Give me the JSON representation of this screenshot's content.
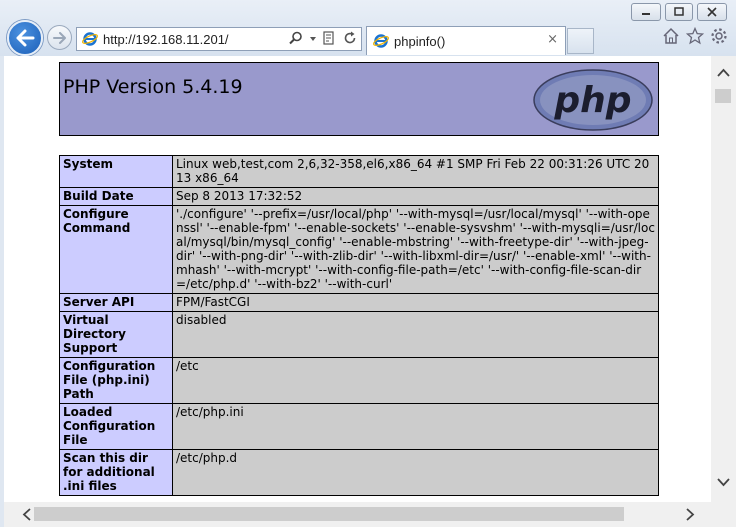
{
  "browser": {
    "address": "http://192.168.11.201/",
    "tab_title": "phpinfo()",
    "tab_close_glyph": "×",
    "colors": {
      "accent": "#1b5fb8",
      "chrome": "#dfe7f1"
    }
  },
  "page": {
    "header_title": "PHP Version 5.4.19",
    "logo_text": "php",
    "colors": {
      "header_bg": "#9999cc",
      "key_bg": "#ccccff",
      "value_bg": "#cccccc"
    },
    "rows": [
      {
        "key": "System",
        "value": "Linux web,test,com 2,6,32-358,el6,x86_64 #1 SMP Fri Feb 22 00:31:26 UTC 2013 x86_64"
      },
      {
        "key": "Build Date",
        "value": "Sep 8 2013 17:32:52"
      },
      {
        "key": "Configure Command",
        "value": "'./configure' '--prefix=/usr/local/php' '--with-mysql=/usr/local/mysql' '--with-openssl' '--enable-fpm' '--enable-sockets' '--enable-sysvshm' '--with-mysqli=/usr/local/mysql/bin/mysql_config' '--enable-mbstring' '--with-freetype-dir' '--with-jpeg-dir' '--with-png-dir' '--with-zlib-dir' '--with-libxml-dir=/usr/' '--enable-xml' '--with-mhash' '--with-mcrypt' '--with-config-file-path=/etc' '--with-config-file-scan-dir=/etc/php.d' '--with-bz2' '--with-curl'"
      },
      {
        "key": "Server API",
        "value": "FPM/FastCGI"
      },
      {
        "key": "Virtual Directory Support",
        "value": "disabled"
      },
      {
        "key": "Configuration File (php.ini) Path",
        "value": "/etc"
      },
      {
        "key": "Loaded Configuration File",
        "value": "/etc/php.ini"
      },
      {
        "key": "Scan this dir for additional .ini files",
        "value": "/etc/php.d"
      }
    ]
  }
}
